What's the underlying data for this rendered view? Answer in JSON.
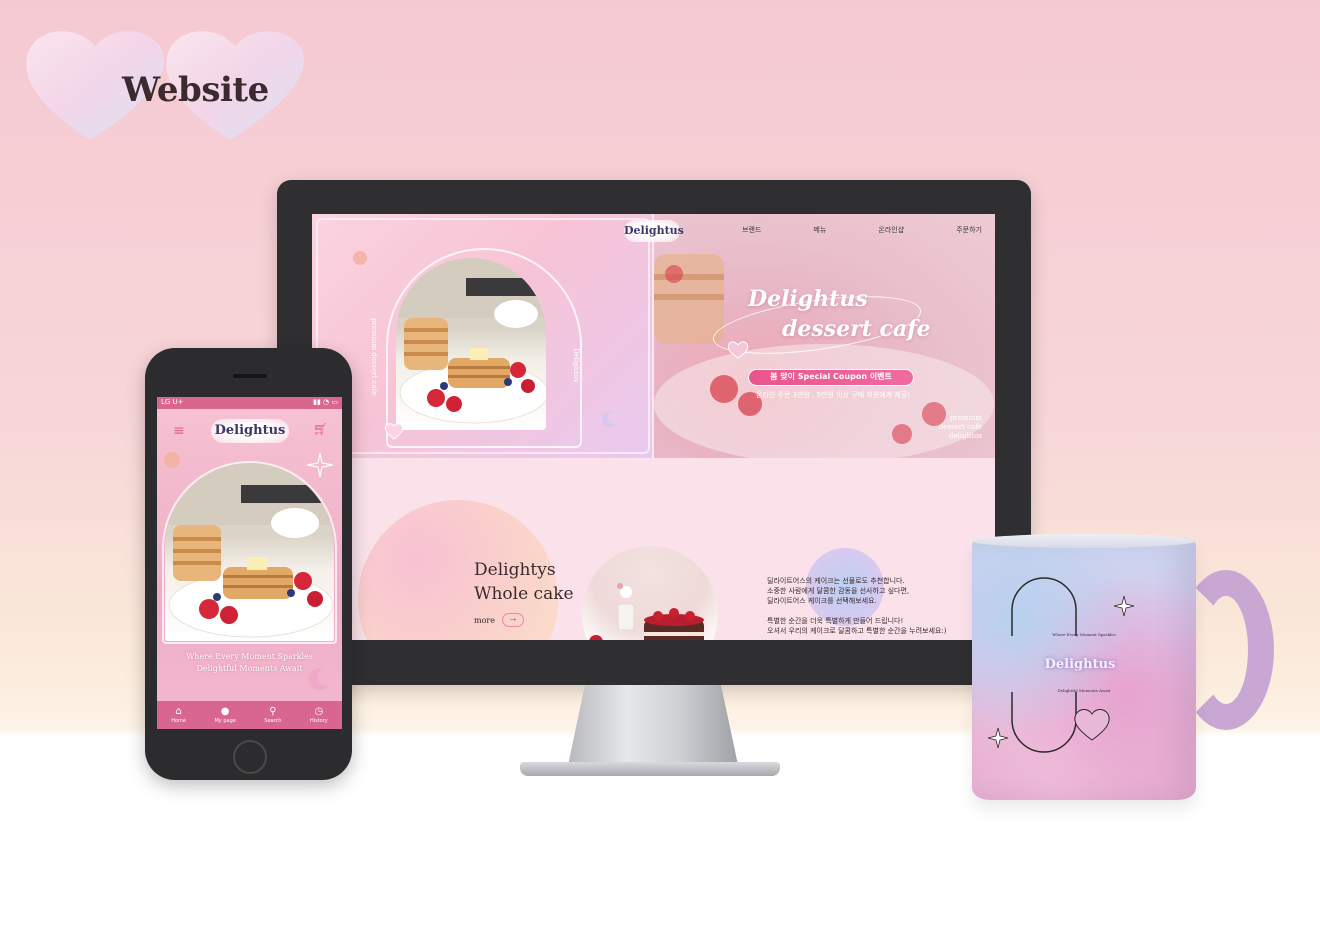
{
  "badge": {
    "title": "Website"
  },
  "desktop": {
    "logo": "Delightus",
    "nav": [
      "브랜드",
      "메뉴",
      "온라인샵",
      "주문하기"
    ],
    "hero": {
      "vertical_left": "premium dessert cafe",
      "vertical_right": "Delightus",
      "title_line1": "Delightus",
      "title_line2": "dessert cafe",
      "coupon_label": "봄 맞이 Special Coupon 이벤트",
      "coupon_sub": "온라인 주문 3만원 , 5만원 이상 구매 회원에게 제공!",
      "corner_lines": [
        "premium",
        "dessert cafe",
        "delightus"
      ]
    },
    "section": {
      "title_line1": "Delightys",
      "title_line2": "Whole cake",
      "more": "more",
      "desc_lines": [
        "딜라이트어스의 케이크는 선물로도 추천합니다.",
        "소중한 사람에게 달콤한 감동을 선사하고 싶다면,",
        "딜라이트어스 케이크를 선택해보세요.",
        "",
        "특별한 순간을 더욱 특별하게 만들어 드립니다!",
        "오셔서 우리의 케이크로 달콤하고 특별한 순간을 누려보세요:)"
      ]
    }
  },
  "phone": {
    "carrier": "LG U+",
    "logo": "Delightus",
    "tagline_line1": "Where Every Moment Sparkles",
    "tagline_line2": "Delightful Moments Await",
    "tabs": [
      {
        "label": "Home",
        "icon": "home-icon"
      },
      {
        "label": "My page",
        "icon": "user-icon"
      },
      {
        "label": "Search",
        "icon": "search-icon"
      },
      {
        "label": "History",
        "icon": "history-icon"
      }
    ]
  },
  "mug": {
    "text_top": "Where Every Moment Sparkles",
    "logo": "Delightus",
    "text_bottom": "Delightful Moments Await"
  },
  "colors": {
    "accent_pink": "#d9668f",
    "coupon_pink": "#e9558d",
    "logo_navy": "#3c3668"
  }
}
